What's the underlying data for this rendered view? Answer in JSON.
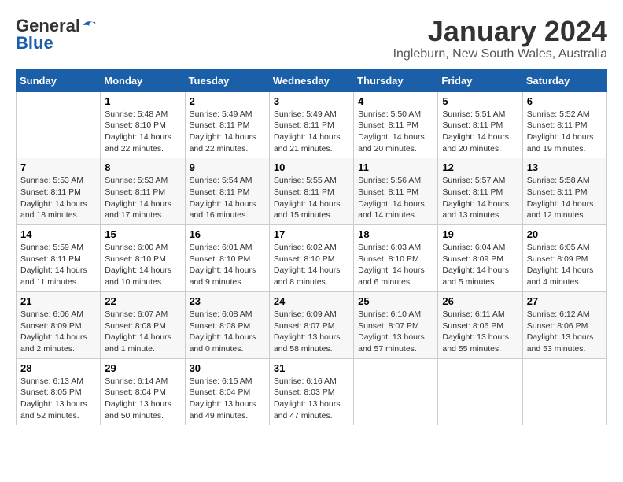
{
  "header": {
    "logo": {
      "general": "General",
      "blue": "Blue"
    },
    "title": "January 2024",
    "subtitle": "Ingleburn, New South Wales, Australia"
  },
  "days_of_week": [
    "Sunday",
    "Monday",
    "Tuesday",
    "Wednesday",
    "Thursday",
    "Friday",
    "Saturday"
  ],
  "weeks": [
    [
      {
        "day": null,
        "info": null
      },
      {
        "day": "1",
        "info": "Sunrise: 5:48 AM\nSunset: 8:10 PM\nDaylight: 14 hours\nand 22 minutes."
      },
      {
        "day": "2",
        "info": "Sunrise: 5:49 AM\nSunset: 8:11 PM\nDaylight: 14 hours\nand 22 minutes."
      },
      {
        "day": "3",
        "info": "Sunrise: 5:49 AM\nSunset: 8:11 PM\nDaylight: 14 hours\nand 21 minutes."
      },
      {
        "day": "4",
        "info": "Sunrise: 5:50 AM\nSunset: 8:11 PM\nDaylight: 14 hours\nand 20 minutes."
      },
      {
        "day": "5",
        "info": "Sunrise: 5:51 AM\nSunset: 8:11 PM\nDaylight: 14 hours\nand 20 minutes."
      },
      {
        "day": "6",
        "info": "Sunrise: 5:52 AM\nSunset: 8:11 PM\nDaylight: 14 hours\nand 19 minutes."
      }
    ],
    [
      {
        "day": "7",
        "info": "Sunrise: 5:53 AM\nSunset: 8:11 PM\nDaylight: 14 hours\nand 18 minutes."
      },
      {
        "day": "8",
        "info": "Sunrise: 5:53 AM\nSunset: 8:11 PM\nDaylight: 14 hours\nand 17 minutes."
      },
      {
        "day": "9",
        "info": "Sunrise: 5:54 AM\nSunset: 8:11 PM\nDaylight: 14 hours\nand 16 minutes."
      },
      {
        "day": "10",
        "info": "Sunrise: 5:55 AM\nSunset: 8:11 PM\nDaylight: 14 hours\nand 15 minutes."
      },
      {
        "day": "11",
        "info": "Sunrise: 5:56 AM\nSunset: 8:11 PM\nDaylight: 14 hours\nand 14 minutes."
      },
      {
        "day": "12",
        "info": "Sunrise: 5:57 AM\nSunset: 8:11 PM\nDaylight: 14 hours\nand 13 minutes."
      },
      {
        "day": "13",
        "info": "Sunrise: 5:58 AM\nSunset: 8:11 PM\nDaylight: 14 hours\nand 12 minutes."
      }
    ],
    [
      {
        "day": "14",
        "info": "Sunrise: 5:59 AM\nSunset: 8:11 PM\nDaylight: 14 hours\nand 11 minutes."
      },
      {
        "day": "15",
        "info": "Sunrise: 6:00 AM\nSunset: 8:10 PM\nDaylight: 14 hours\nand 10 minutes."
      },
      {
        "day": "16",
        "info": "Sunrise: 6:01 AM\nSunset: 8:10 PM\nDaylight: 14 hours\nand 9 minutes."
      },
      {
        "day": "17",
        "info": "Sunrise: 6:02 AM\nSunset: 8:10 PM\nDaylight: 14 hours\nand 8 minutes."
      },
      {
        "day": "18",
        "info": "Sunrise: 6:03 AM\nSunset: 8:10 PM\nDaylight: 14 hours\nand 6 minutes."
      },
      {
        "day": "19",
        "info": "Sunrise: 6:04 AM\nSunset: 8:09 PM\nDaylight: 14 hours\nand 5 minutes."
      },
      {
        "day": "20",
        "info": "Sunrise: 6:05 AM\nSunset: 8:09 PM\nDaylight: 14 hours\nand 4 minutes."
      }
    ],
    [
      {
        "day": "21",
        "info": "Sunrise: 6:06 AM\nSunset: 8:09 PM\nDaylight: 14 hours\nand 2 minutes."
      },
      {
        "day": "22",
        "info": "Sunrise: 6:07 AM\nSunset: 8:08 PM\nDaylight: 14 hours\nand 1 minute."
      },
      {
        "day": "23",
        "info": "Sunrise: 6:08 AM\nSunset: 8:08 PM\nDaylight: 14 hours\nand 0 minutes."
      },
      {
        "day": "24",
        "info": "Sunrise: 6:09 AM\nSunset: 8:07 PM\nDaylight: 13 hours\nand 58 minutes."
      },
      {
        "day": "25",
        "info": "Sunrise: 6:10 AM\nSunset: 8:07 PM\nDaylight: 13 hours\nand 57 minutes."
      },
      {
        "day": "26",
        "info": "Sunrise: 6:11 AM\nSunset: 8:06 PM\nDaylight: 13 hours\nand 55 minutes."
      },
      {
        "day": "27",
        "info": "Sunrise: 6:12 AM\nSunset: 8:06 PM\nDaylight: 13 hours\nand 53 minutes."
      }
    ],
    [
      {
        "day": "28",
        "info": "Sunrise: 6:13 AM\nSunset: 8:05 PM\nDaylight: 13 hours\nand 52 minutes."
      },
      {
        "day": "29",
        "info": "Sunrise: 6:14 AM\nSunset: 8:04 PM\nDaylight: 13 hours\nand 50 minutes."
      },
      {
        "day": "30",
        "info": "Sunrise: 6:15 AM\nSunset: 8:04 PM\nDaylight: 13 hours\nand 49 minutes."
      },
      {
        "day": "31",
        "info": "Sunrise: 6:16 AM\nSunset: 8:03 PM\nDaylight: 13 hours\nand 47 minutes."
      },
      {
        "day": null,
        "info": null
      },
      {
        "day": null,
        "info": null
      },
      {
        "day": null,
        "info": null
      }
    ]
  ]
}
